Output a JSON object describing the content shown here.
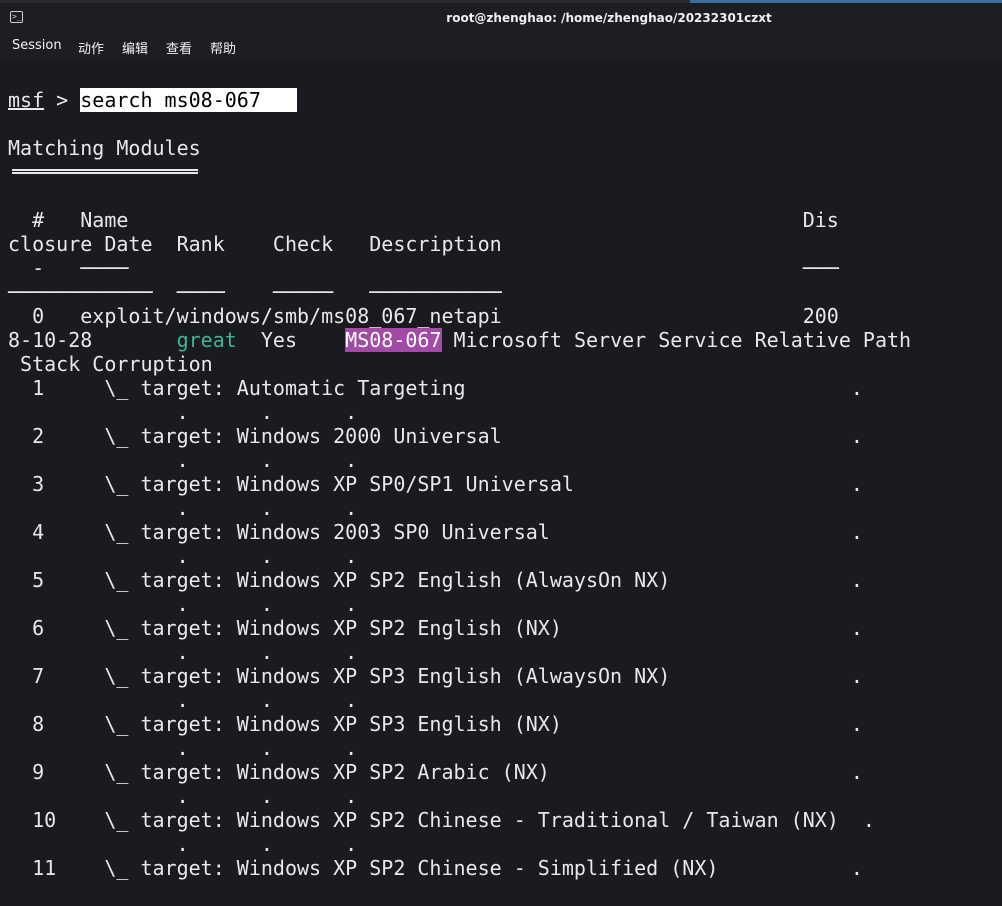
{
  "window": {
    "title": "root@zhenghao: /home/zhenghao/20232301czxt",
    "icon": "terminal-icon"
  },
  "menu": {
    "session": "Session",
    "action": "动作",
    "edit": "编辑",
    "view": "查看",
    "help": "帮助"
  },
  "terminal": {
    "prompt_name": "msf",
    "prompt_sep": " > ",
    "command": "search ms08-067   ",
    "heading": "Matching Modules",
    "header_line1": "  #   Name                                                        Dis",
    "header_line2_a": "closure Date  Rank    Check   Description",
    "dash_line1": "  -   ────                                                        ───",
    "dash_line2": "────────────  ────    ─────   ───────────",
    "row0_line1": "  0   exploit/windows/smb/ms08_067_netapi                         200",
    "row0_date": "8-10-28       ",
    "row0_rank": "great",
    "row0_check": "  Yes    ",
    "row0_match": "MS08-067",
    "row0_desc": " Microsoft Server Service Relative Path",
    "row0_line3": " Stack Corruption",
    "dots_line": "              .      .      .",
    "targets": [
      "  1     \\_ target: Automatic Targeting                                .",
      "  2     \\_ target: Windows 2000 Universal                             .",
      "  3     \\_ target: Windows XP SP0/SP1 Universal                       .",
      "  4     \\_ target: Windows 2003 SP0 Universal                         .",
      "  5     \\_ target: Windows XP SP2 English (AlwaysOn NX)               .",
      "  6     \\_ target: Windows XP SP2 English (NX)                        .",
      "  7     \\_ target: Windows XP SP3 English (AlwaysOn NX)               .",
      "  8     \\_ target: Windows XP SP3 English (NX)                        .",
      "  9     \\_ target: Windows XP SP2 Arabic (NX)                         .",
      "  10    \\_ target: Windows XP SP2 Chinese - Traditional / Taiwan (NX)  .",
      "  11    \\_ target: Windows XP SP2 Chinese - Simplified (NX)           ."
    ]
  }
}
